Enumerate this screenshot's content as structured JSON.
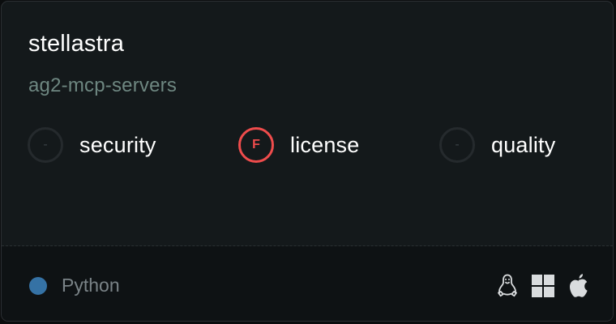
{
  "repo": {
    "owner": "stellastra",
    "name": "ag2-mcp-servers"
  },
  "scores": [
    {
      "grade": "-",
      "label": "security",
      "status": "empty"
    },
    {
      "grade": "F",
      "label": "license",
      "status": "fail"
    },
    {
      "grade": "-",
      "label": "quality",
      "status": "empty"
    }
  ],
  "footer": {
    "language": "Python",
    "language_color": "#3572a5",
    "platforms": [
      "linux-icon",
      "windows-icon",
      "apple-icon"
    ]
  },
  "colors": {
    "fail": "#ef4c4c",
    "repo_name": "#6e8781"
  }
}
